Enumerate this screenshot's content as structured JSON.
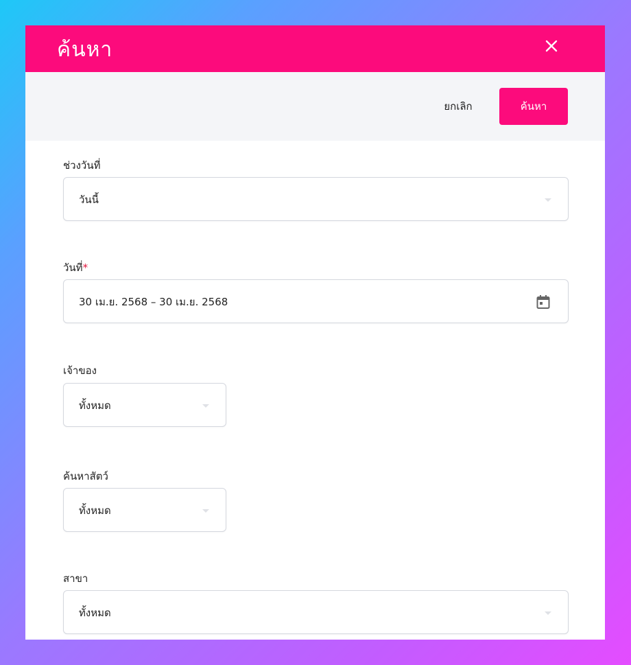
{
  "dialog": {
    "title": "ค้นหา",
    "close_icon": "close-icon"
  },
  "toolbar": {
    "cancel_label": "ยกเลิก",
    "search_label": "ค้นหา"
  },
  "form": {
    "date_range": {
      "label": "ช่วงวันที่",
      "value": "วันนี้"
    },
    "date": {
      "label": "วันที่",
      "required_mark": "*",
      "value": "30 เม.ย. 2568 – 30 เม.ย. 2568",
      "icon": "calendar-icon"
    },
    "owner": {
      "label": "เจ้าของ",
      "value": "ทั้งหมด"
    },
    "pet_search": {
      "label": "ค้นหาสัตว์",
      "value": "ทั้งหมด"
    },
    "branch": {
      "label": "สาขา",
      "value": "ทั้งหมด"
    }
  },
  "colors": {
    "accent": "#fc0b7c",
    "toolbar_bg": "#f4f5f8",
    "required": "#e0183f"
  }
}
